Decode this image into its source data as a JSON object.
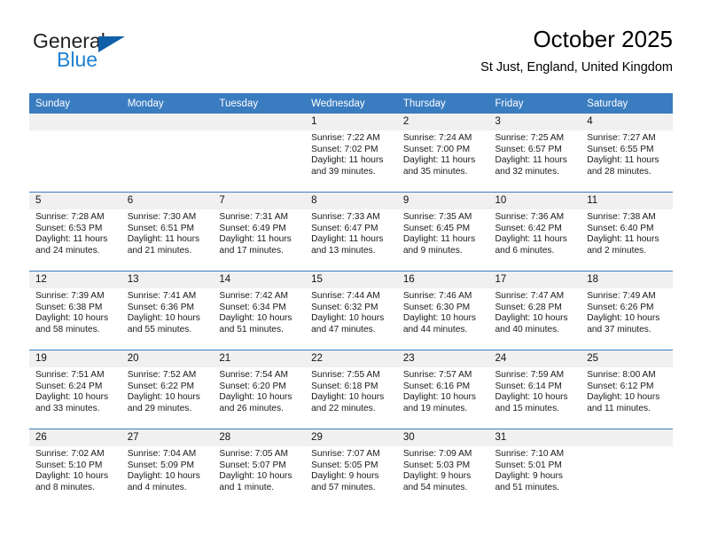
{
  "brand": {
    "name_part1": "General",
    "name_part2": "Blue",
    "logo_icon": "triangle-logo-icon"
  },
  "header": {
    "title": "October 2025",
    "subtitle": "St Just, England, United Kingdom"
  },
  "colors": {
    "header_blue": "#3a7cc0",
    "brand_blue": "#1f7fd1",
    "logo_blue": "#1060a8",
    "daynum_band": "#f0f0f0"
  },
  "weekday_headers": [
    "Sunday",
    "Monday",
    "Tuesday",
    "Wednesday",
    "Thursday",
    "Friday",
    "Saturday"
  ],
  "weeks": [
    [
      {
        "day": "",
        "empty": true,
        "sunrise": "",
        "sunset": "",
        "daylight_line1": "",
        "daylight_line2": ""
      },
      {
        "day": "",
        "empty": true,
        "sunrise": "",
        "sunset": "",
        "daylight_line1": "",
        "daylight_line2": ""
      },
      {
        "day": "",
        "empty": true,
        "sunrise": "",
        "sunset": "",
        "daylight_line1": "",
        "daylight_line2": ""
      },
      {
        "day": "1",
        "empty": false,
        "sunrise": "Sunrise: 7:22 AM",
        "sunset": "Sunset: 7:02 PM",
        "daylight_line1": "Daylight: 11 hours",
        "daylight_line2": "and 39 minutes."
      },
      {
        "day": "2",
        "empty": false,
        "sunrise": "Sunrise: 7:24 AM",
        "sunset": "Sunset: 7:00 PM",
        "daylight_line1": "Daylight: 11 hours",
        "daylight_line2": "and 35 minutes."
      },
      {
        "day": "3",
        "empty": false,
        "sunrise": "Sunrise: 7:25 AM",
        "sunset": "Sunset: 6:57 PM",
        "daylight_line1": "Daylight: 11 hours",
        "daylight_line2": "and 32 minutes."
      },
      {
        "day": "4",
        "empty": false,
        "sunrise": "Sunrise: 7:27 AM",
        "sunset": "Sunset: 6:55 PM",
        "daylight_line1": "Daylight: 11 hours",
        "daylight_line2": "and 28 minutes."
      }
    ],
    [
      {
        "day": "5",
        "empty": false,
        "sunrise": "Sunrise: 7:28 AM",
        "sunset": "Sunset: 6:53 PM",
        "daylight_line1": "Daylight: 11 hours",
        "daylight_line2": "and 24 minutes."
      },
      {
        "day": "6",
        "empty": false,
        "sunrise": "Sunrise: 7:30 AM",
        "sunset": "Sunset: 6:51 PM",
        "daylight_line1": "Daylight: 11 hours",
        "daylight_line2": "and 21 minutes."
      },
      {
        "day": "7",
        "empty": false,
        "sunrise": "Sunrise: 7:31 AM",
        "sunset": "Sunset: 6:49 PM",
        "daylight_line1": "Daylight: 11 hours",
        "daylight_line2": "and 17 minutes."
      },
      {
        "day": "8",
        "empty": false,
        "sunrise": "Sunrise: 7:33 AM",
        "sunset": "Sunset: 6:47 PM",
        "daylight_line1": "Daylight: 11 hours",
        "daylight_line2": "and 13 minutes."
      },
      {
        "day": "9",
        "empty": false,
        "sunrise": "Sunrise: 7:35 AM",
        "sunset": "Sunset: 6:45 PM",
        "daylight_line1": "Daylight: 11 hours",
        "daylight_line2": "and 9 minutes."
      },
      {
        "day": "10",
        "empty": false,
        "sunrise": "Sunrise: 7:36 AM",
        "sunset": "Sunset: 6:42 PM",
        "daylight_line1": "Daylight: 11 hours",
        "daylight_line2": "and 6 minutes."
      },
      {
        "day": "11",
        "empty": false,
        "sunrise": "Sunrise: 7:38 AM",
        "sunset": "Sunset: 6:40 PM",
        "daylight_line1": "Daylight: 11 hours",
        "daylight_line2": "and 2 minutes."
      }
    ],
    [
      {
        "day": "12",
        "empty": false,
        "sunrise": "Sunrise: 7:39 AM",
        "sunset": "Sunset: 6:38 PM",
        "daylight_line1": "Daylight: 10 hours",
        "daylight_line2": "and 58 minutes."
      },
      {
        "day": "13",
        "empty": false,
        "sunrise": "Sunrise: 7:41 AM",
        "sunset": "Sunset: 6:36 PM",
        "daylight_line1": "Daylight: 10 hours",
        "daylight_line2": "and 55 minutes."
      },
      {
        "day": "14",
        "empty": false,
        "sunrise": "Sunrise: 7:42 AM",
        "sunset": "Sunset: 6:34 PM",
        "daylight_line1": "Daylight: 10 hours",
        "daylight_line2": "and 51 minutes."
      },
      {
        "day": "15",
        "empty": false,
        "sunrise": "Sunrise: 7:44 AM",
        "sunset": "Sunset: 6:32 PM",
        "daylight_line1": "Daylight: 10 hours",
        "daylight_line2": "and 47 minutes."
      },
      {
        "day": "16",
        "empty": false,
        "sunrise": "Sunrise: 7:46 AM",
        "sunset": "Sunset: 6:30 PM",
        "daylight_line1": "Daylight: 10 hours",
        "daylight_line2": "and 44 minutes."
      },
      {
        "day": "17",
        "empty": false,
        "sunrise": "Sunrise: 7:47 AM",
        "sunset": "Sunset: 6:28 PM",
        "daylight_line1": "Daylight: 10 hours",
        "daylight_line2": "and 40 minutes."
      },
      {
        "day": "18",
        "empty": false,
        "sunrise": "Sunrise: 7:49 AM",
        "sunset": "Sunset: 6:26 PM",
        "daylight_line1": "Daylight: 10 hours",
        "daylight_line2": "and 37 minutes."
      }
    ],
    [
      {
        "day": "19",
        "empty": false,
        "sunrise": "Sunrise: 7:51 AM",
        "sunset": "Sunset: 6:24 PM",
        "daylight_line1": "Daylight: 10 hours",
        "daylight_line2": "and 33 minutes."
      },
      {
        "day": "20",
        "empty": false,
        "sunrise": "Sunrise: 7:52 AM",
        "sunset": "Sunset: 6:22 PM",
        "daylight_line1": "Daylight: 10 hours",
        "daylight_line2": "and 29 minutes."
      },
      {
        "day": "21",
        "empty": false,
        "sunrise": "Sunrise: 7:54 AM",
        "sunset": "Sunset: 6:20 PM",
        "daylight_line1": "Daylight: 10 hours",
        "daylight_line2": "and 26 minutes."
      },
      {
        "day": "22",
        "empty": false,
        "sunrise": "Sunrise: 7:55 AM",
        "sunset": "Sunset: 6:18 PM",
        "daylight_line1": "Daylight: 10 hours",
        "daylight_line2": "and 22 minutes."
      },
      {
        "day": "23",
        "empty": false,
        "sunrise": "Sunrise: 7:57 AM",
        "sunset": "Sunset: 6:16 PM",
        "daylight_line1": "Daylight: 10 hours",
        "daylight_line2": "and 19 minutes."
      },
      {
        "day": "24",
        "empty": false,
        "sunrise": "Sunrise: 7:59 AM",
        "sunset": "Sunset: 6:14 PM",
        "daylight_line1": "Daylight: 10 hours",
        "daylight_line2": "and 15 minutes."
      },
      {
        "day": "25",
        "empty": false,
        "sunrise": "Sunrise: 8:00 AM",
        "sunset": "Sunset: 6:12 PM",
        "daylight_line1": "Daylight: 10 hours",
        "daylight_line2": "and 11 minutes."
      }
    ],
    [
      {
        "day": "26",
        "empty": false,
        "sunrise": "Sunrise: 7:02 AM",
        "sunset": "Sunset: 5:10 PM",
        "daylight_line1": "Daylight: 10 hours",
        "daylight_line2": "and 8 minutes."
      },
      {
        "day": "27",
        "empty": false,
        "sunrise": "Sunrise: 7:04 AM",
        "sunset": "Sunset: 5:09 PM",
        "daylight_line1": "Daylight: 10 hours",
        "daylight_line2": "and 4 minutes."
      },
      {
        "day": "28",
        "empty": false,
        "sunrise": "Sunrise: 7:05 AM",
        "sunset": "Sunset: 5:07 PM",
        "daylight_line1": "Daylight: 10 hours",
        "daylight_line2": "and 1 minute."
      },
      {
        "day": "29",
        "empty": false,
        "sunrise": "Sunrise: 7:07 AM",
        "sunset": "Sunset: 5:05 PM",
        "daylight_line1": "Daylight: 9 hours",
        "daylight_line2": "and 57 minutes."
      },
      {
        "day": "30",
        "empty": false,
        "sunrise": "Sunrise: 7:09 AM",
        "sunset": "Sunset: 5:03 PM",
        "daylight_line1": "Daylight: 9 hours",
        "daylight_line2": "and 54 minutes."
      },
      {
        "day": "31",
        "empty": false,
        "sunrise": "Sunrise: 7:10 AM",
        "sunset": "Sunset: 5:01 PM",
        "daylight_line1": "Daylight: 9 hours",
        "daylight_line2": "and 51 minutes."
      },
      {
        "day": "",
        "empty": true,
        "sunrise": "",
        "sunset": "",
        "daylight_line1": "",
        "daylight_line2": ""
      }
    ]
  ]
}
